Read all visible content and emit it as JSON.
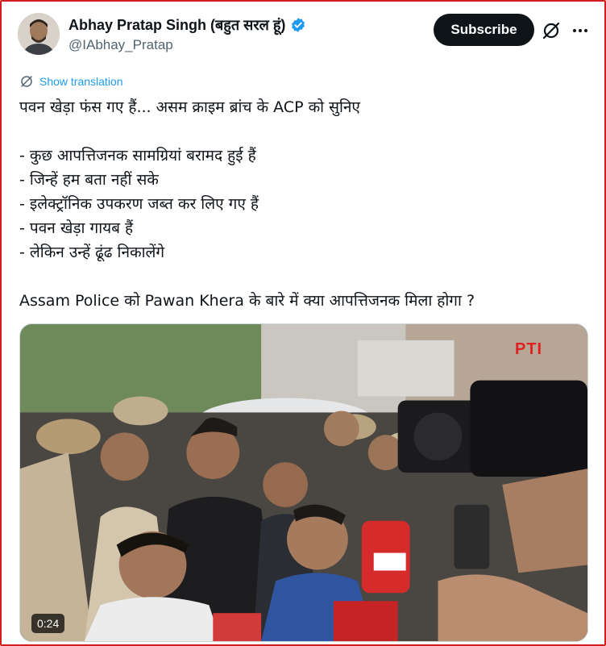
{
  "author": {
    "display_name": "Abhay Pratap Singh (बहुत सरल हूं)",
    "handle": "@IAbhay_Pratap",
    "verified": true
  },
  "actions": {
    "subscribe_label": "Subscribe",
    "grok_icon": "grok-icon",
    "more_icon": "more-icon"
  },
  "translate": {
    "label": "Show translation",
    "icon": "translate-icon"
  },
  "tweet": {
    "line1": "पवन खेड़ा फंस गए हैं... असम क्राइम ब्रांच के ACP को सुनिए",
    "bullet1": "- कुछ आपत्तिजनक सामग्रियां बरामद हुई हैं",
    "bullet2": "- जिन्हें हम बता नहीं सके",
    "bullet3": "- इलेक्ट्रॉनिक उपकरण जब्त कर लिए गए हैं",
    "bullet4": "- पवन खेड़ा गायब हैं",
    "bullet5": "-  लेकिन उन्हें ढूंढ निकालेंगे",
    "last_line": "Assam Police को Pawan Khera के बारे में क्या आपत्तिजनक मिला होगा ?"
  },
  "media": {
    "duration": "0:24",
    "watermark": "PTI"
  },
  "colors": {
    "accent": "#1d9bf0",
    "frame_border": "#d01d1d",
    "button_bg": "#0f1419"
  }
}
